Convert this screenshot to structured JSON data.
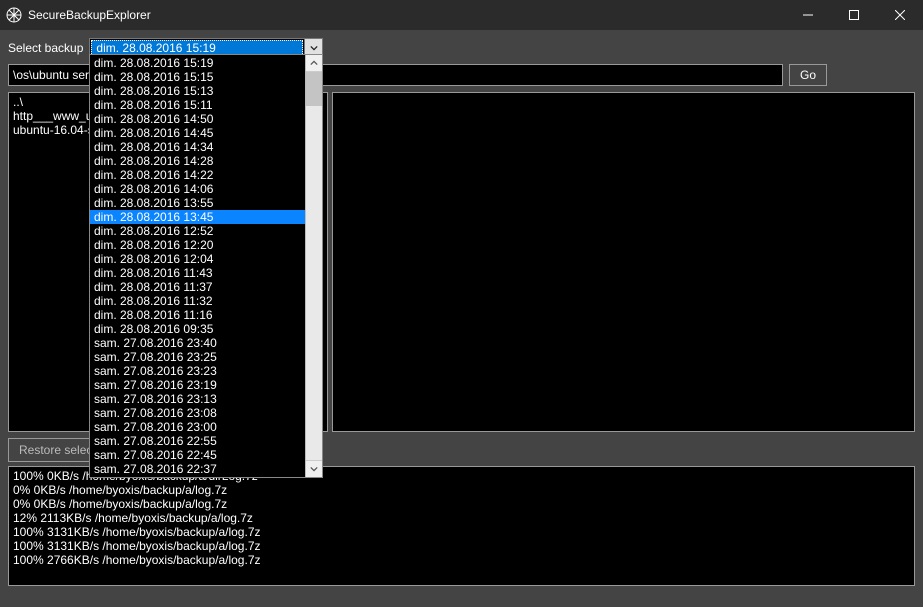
{
  "window": {
    "title": "SecureBackupExplorer"
  },
  "toolbar": {
    "select_label": "Select backup",
    "selected_value": "dim. 28.08.2016 15:19",
    "go_label": "Go",
    "path_value": "\\os\\ubuntu server"
  },
  "restore_label": "Restore selected objects in a folder",
  "file_list": [
    "..\\",
    "http___www_ub…",
    "ubuntu-16.04-se…"
  ],
  "dropdown": {
    "highlighted_index": 11,
    "options": [
      "dim. 28.08.2016 15:19",
      "dim. 28.08.2016 15:15",
      "dim. 28.08.2016 15:13",
      "dim. 28.08.2016 15:11",
      "dim. 28.08.2016 14:50",
      "dim. 28.08.2016 14:45",
      "dim. 28.08.2016 14:34",
      "dim. 28.08.2016 14:28",
      "dim. 28.08.2016 14:22",
      "dim. 28.08.2016 14:06",
      "dim. 28.08.2016 13:55",
      "dim. 28.08.2016 13:45",
      "dim. 28.08.2016 12:52",
      "dim. 28.08.2016 12:20",
      "dim. 28.08.2016 12:04",
      "dim. 28.08.2016 11:43",
      "dim. 28.08.2016 11:37",
      "dim. 28.08.2016 11:32",
      "dim. 28.08.2016 11:16",
      "dim. 28.08.2016 09:35",
      "sam. 27.08.2016 23:40",
      "sam. 27.08.2016 23:25",
      "sam. 27.08.2016 23:23",
      "sam. 27.08.2016 23:19",
      "sam. 27.08.2016 23:13",
      "sam. 27.08.2016 23:08",
      "sam. 27.08.2016 23:00",
      "sam. 27.08.2016 22:55",
      "sam. 27.08.2016 22:45",
      "sam. 27.08.2016 22:37"
    ]
  },
  "log_lines": [
    "100% 0KB/s /home/byoxis/backup/a/dirLog.7z",
    "0% 0KB/s /home/byoxis/backup/a/log.7z",
    "0% 0KB/s /home/byoxis/backup/a/log.7z",
    "12% 2113KB/s /home/byoxis/backup/a/log.7z",
    "100% 3131KB/s /home/byoxis/backup/a/log.7z",
    "100% 3131KB/s /home/byoxis/backup/a/log.7z",
    "100% 2766KB/s /home/byoxis/backup/a/log.7z"
  ]
}
